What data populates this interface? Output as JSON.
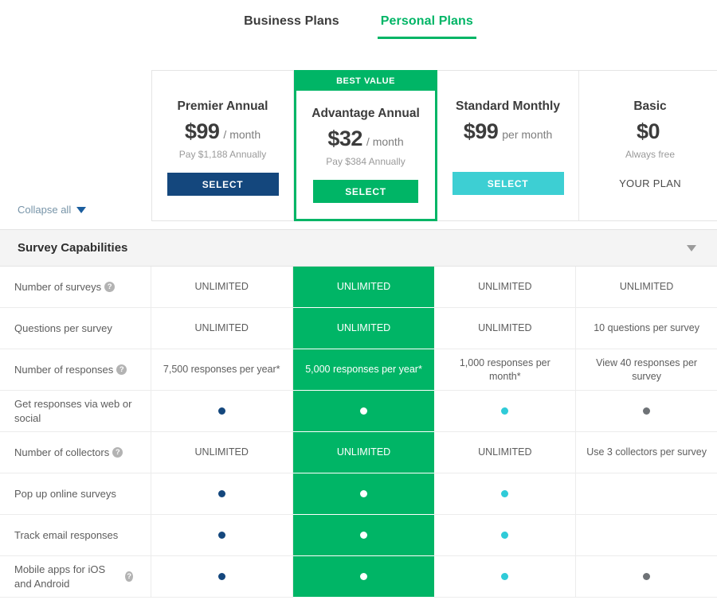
{
  "tabs": [
    {
      "label": "Business Plans",
      "active": false
    },
    {
      "label": "Personal Plans",
      "active": true
    }
  ],
  "badge": {
    "best_value": "BEST VALUE"
  },
  "plans": [
    {
      "name": "Premier Annual",
      "price": "$99",
      "unit": "/ month",
      "sub": "Pay $1,188 Annually",
      "cta": "SELECT",
      "cta_style": "navy",
      "featured": false
    },
    {
      "name": "Advantage Annual",
      "price": "$32",
      "unit": "/ month",
      "sub": "Pay $384 Annually",
      "cta": "SELECT",
      "cta_style": "green",
      "featured": true
    },
    {
      "name": "Standard Monthly",
      "price": "$99",
      "unit": "per month",
      "sub": "",
      "cta": "SELECT",
      "cta_style": "cyan",
      "featured": false
    },
    {
      "name": "Basic",
      "price": "$0",
      "unit": "",
      "sub": "Always free",
      "cta": "YOUR PLAN",
      "cta_style": "text",
      "featured": false
    }
  ],
  "collapse_all": {
    "label": "Collapse all",
    "icon": "triangle-down-icon"
  },
  "section": {
    "title": "Survey Capabilities",
    "chevron": "triangle-down-icon"
  },
  "help_glyph": "?",
  "rows": [
    {
      "label": "Number of surveys",
      "help": true,
      "cells": [
        {
          "type": "text",
          "value": "UNLIMITED"
        },
        {
          "type": "text",
          "value": "UNLIMITED"
        },
        {
          "type": "text",
          "value": "UNLIMITED"
        },
        {
          "type": "text",
          "value": "UNLIMITED"
        }
      ]
    },
    {
      "label": "Questions per survey",
      "help": false,
      "cells": [
        {
          "type": "text",
          "value": "UNLIMITED"
        },
        {
          "type": "text",
          "value": "UNLIMITED"
        },
        {
          "type": "text",
          "value": "UNLIMITED"
        },
        {
          "type": "text",
          "value": "10 questions per survey"
        }
      ]
    },
    {
      "label": "Number of responses",
      "help": true,
      "cells": [
        {
          "type": "text",
          "value": "7,500 responses per year*"
        },
        {
          "type": "text",
          "value": "5,000 responses per year*"
        },
        {
          "type": "text",
          "value": "1,000 responses per month*"
        },
        {
          "type": "text",
          "value": "View 40 responses per survey"
        }
      ]
    },
    {
      "label": "Get responses via web or social",
      "help": false,
      "cells": [
        {
          "type": "dot",
          "color": "navy"
        },
        {
          "type": "dot",
          "color": "white"
        },
        {
          "type": "dot",
          "color": "cyan"
        },
        {
          "type": "dot",
          "color": "gray"
        }
      ]
    },
    {
      "label": "Number of collectors",
      "help": true,
      "cells": [
        {
          "type": "text",
          "value": "UNLIMITED"
        },
        {
          "type": "text",
          "value": "UNLIMITED"
        },
        {
          "type": "text",
          "value": "UNLIMITED"
        },
        {
          "type": "text",
          "value": "Use 3 collectors per survey"
        }
      ]
    },
    {
      "label": "Pop up online surveys",
      "help": false,
      "cells": [
        {
          "type": "dot",
          "color": "navy"
        },
        {
          "type": "dot",
          "color": "white"
        },
        {
          "type": "dot",
          "color": "cyan"
        },
        {
          "type": "empty"
        }
      ]
    },
    {
      "label": "Track email responses",
      "help": false,
      "cells": [
        {
          "type": "dot",
          "color": "navy"
        },
        {
          "type": "dot",
          "color": "white"
        },
        {
          "type": "dot",
          "color": "cyan"
        },
        {
          "type": "empty"
        }
      ]
    },
    {
      "label": "Mobile apps for iOS and Android",
      "help": true,
      "cells": [
        {
          "type": "dot",
          "color": "navy"
        },
        {
          "type": "dot",
          "color": "white"
        },
        {
          "type": "dot",
          "color": "cyan"
        },
        {
          "type": "dot",
          "color": "gray"
        }
      ]
    }
  ],
  "colors": {
    "green": "#00b566",
    "navy": "#14477d",
    "cyan": "#3dcfd3",
    "gray_dot": "#6e7276",
    "link": "#7794a8"
  }
}
